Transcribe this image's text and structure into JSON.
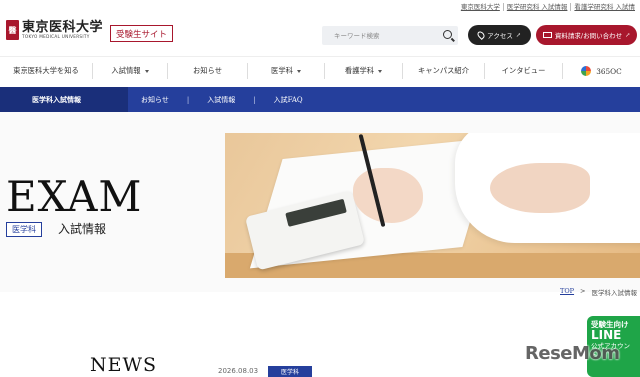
{
  "top_links": [
    "東京医科大学",
    "医学研究科 入試情報",
    "看護学研究科 入試情"
  ],
  "header": {
    "logo_mark": "醫",
    "logo_ja": "東京医科大学",
    "logo_en": "TOKYO MEDICAL UNIVERSITY",
    "site_badge": "受験生サイト",
    "search_placeholder": "キーワード検索",
    "access_label": "アクセス",
    "request_label": "資料請求/お問い合わせ"
  },
  "main_nav": [
    {
      "label": "東京医科大学を知る",
      "dropdown": false
    },
    {
      "label": "入試情報",
      "dropdown": true
    },
    {
      "label": "お知らせ",
      "dropdown": false
    },
    {
      "label": "医学科",
      "dropdown": true
    },
    {
      "label": "看護学科",
      "dropdown": true
    },
    {
      "label": "キャンパス紹介",
      "dropdown": false
    },
    {
      "label": "インタビュー",
      "dropdown": false
    },
    {
      "label": "365OC",
      "dropdown": false
    }
  ],
  "sub_nav": {
    "active": "医学科入試情報",
    "links": [
      "お知らせ",
      "入試情報",
      "入試FAQ"
    ]
  },
  "hero": {
    "title": "EXAM",
    "dept_badge": "医学科",
    "subtitle": "入試情報"
  },
  "breadcrumb": {
    "home": "TOP",
    "separator": ">",
    "current": "医学科入試情報"
  },
  "news": {
    "title": "NEWS",
    "date": "2026.08.03",
    "tag": "医学科"
  },
  "line_banner": {
    "line1": "受験生向け",
    "line2": "LINE",
    "line3": "公式アカウント"
  },
  "watermark": "ReseMom",
  "colors": {
    "brand_red": "#a8172d",
    "brand_blue": "#253f9c",
    "line_green": "#1fa548"
  }
}
